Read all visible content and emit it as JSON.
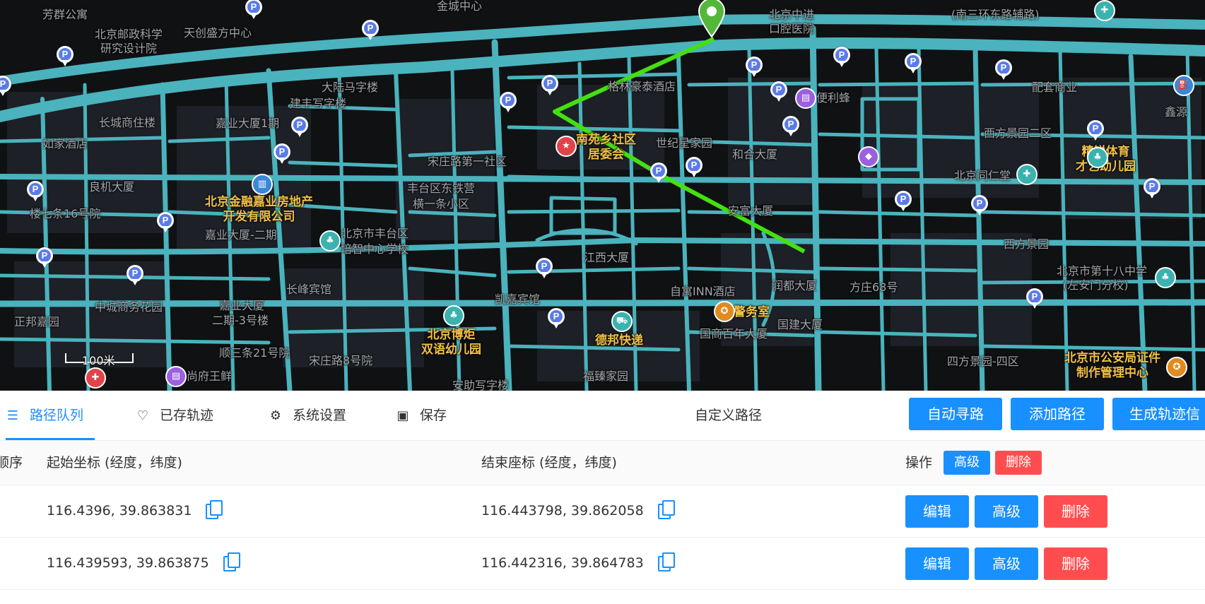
{
  "map": {
    "scale_label": "100米",
    "labels": [
      {
        "text": "芳群公寓"
      },
      {
        "text": "北京邮政科学"
      },
      {
        "text": "研究设计院"
      },
      {
        "text": "天创盛方中心"
      },
      {
        "text": "金城中心"
      },
      {
        "text": "北京中进"
      },
      {
        "text": "口腔医院"
      },
      {
        "text": "(南三环东路辅路)"
      },
      {
        "text": "大陆马字楼"
      },
      {
        "text": "建丰写字楼"
      },
      {
        "text": "格林豪泰酒店"
      },
      {
        "text": "便利蜂"
      },
      {
        "text": "配套商业"
      },
      {
        "text": "长城商住楼"
      },
      {
        "text": "嘉业大厦1期"
      },
      {
        "text": "如家酒店"
      },
      {
        "text": "世纪星家园"
      },
      {
        "text": "和合大厦"
      },
      {
        "text": "宋庄路第一社区"
      },
      {
        "text": "西方景园二区"
      },
      {
        "text": "北京同仁堂"
      },
      {
        "text": "良机大厦"
      },
      {
        "text": "丰台区东铁营"
      },
      {
        "text": "横一条小区"
      },
      {
        "text": "安富大厦"
      },
      {
        "text": "楼七条16号院"
      },
      {
        "text": "嘉业大厦-二期"
      },
      {
        "text": "北京市丰台区"
      },
      {
        "text": "培智中心学校"
      },
      {
        "text": "西方景园"
      },
      {
        "text": "江西大厦"
      },
      {
        "text": "北京市第十八中学"
      },
      {
        "text": "(左安门分校)"
      },
      {
        "text": "长峰宾馆"
      },
      {
        "text": "凯嘉宾馆"
      },
      {
        "text": "自寓INN酒店"
      },
      {
        "text": "润都大厦"
      },
      {
        "text": "方庄68号"
      },
      {
        "text": "中城商务花园"
      },
      {
        "text": "嘉业大厦"
      },
      {
        "text": "二期-3号楼"
      },
      {
        "text": "正邦嘉园"
      },
      {
        "text": "国商百年大厦"
      },
      {
        "text": "国建大厦"
      },
      {
        "text": "顺三条21号院"
      },
      {
        "text": "宋庄路8号院"
      },
      {
        "text": "四方景园-四区"
      },
      {
        "text": "福臻家园"
      },
      {
        "text": "安助写字楼"
      },
      {
        "text": "鑫源"
      },
      {
        "text": "尚府王鲜"
      }
    ],
    "poi_labels": [
      {
        "text": "南苑乡社区\n居委会"
      },
      {
        "text": "北京金融嘉业房地产\n开发有限公司"
      },
      {
        "text": "北京博炬\n双语幼儿园"
      },
      {
        "text": "德邦快递"
      },
      {
        "text": "警务室"
      },
      {
        "text": "北京市公安局证件\n制作管理中心"
      },
      {
        "text": "精锐体育\n才艺幼儿园"
      }
    ],
    "colors": {
      "background": "#101113",
      "road": "#4ab3bd",
      "route": "#44e011",
      "marker": "#53b83a"
    }
  },
  "toolbar": {
    "tabs": [
      {
        "label": "路径队列",
        "icon": "list-icon",
        "active": true
      },
      {
        "label": "已存轨迹",
        "icon": "heart-icon",
        "active": false
      },
      {
        "label": "系统设置",
        "icon": "gear-icon",
        "active": false
      },
      {
        "label": "保存",
        "icon": "save-icon",
        "active": false
      }
    ],
    "title": "自定义路径",
    "buttons": {
      "auto": "自动寻路",
      "add": "添加路径",
      "generate": "生成轨迹信"
    }
  },
  "table": {
    "headers": {
      "order": "顺序",
      "start": "起始坐标 (经度，纬度)",
      "end": "结束座标 (经度，纬度)",
      "ops": "操作",
      "advanced": "高级",
      "delete": "删除"
    },
    "rows": [
      {
        "start": "116.4396, 39.863831",
        "end": "116.443798, 39.862058",
        "edit": "编辑",
        "advanced": "高级",
        "delete": "删除"
      },
      {
        "start": "116.439593, 39.863875",
        "end": "116.442316, 39.864783",
        "edit": "编辑",
        "advanced": "高级",
        "delete": "删除"
      }
    ]
  },
  "theme": {
    "primary": "#1890ff",
    "danger": "#ff4d4f",
    "header_bg": "#fafafa"
  }
}
